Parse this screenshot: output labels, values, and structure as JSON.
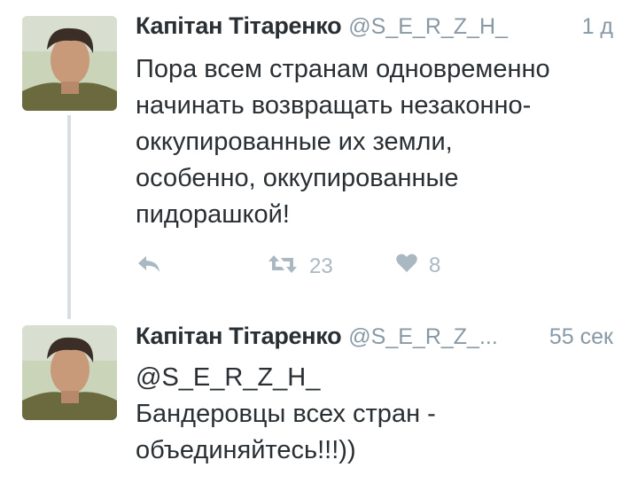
{
  "tweets": [
    {
      "author_name": "Капітан Тітаренко",
      "handle": "@S_E_R_Z_H_",
      "time": "1 д",
      "text": "Пора всем странам одновременно\nначинать возвращать незаконно-\nоккупированные их земли,\nособенно, оккупированные\nпидорашкой!",
      "retweets": "23",
      "likes": "8"
    },
    {
      "author_name": "Капітан Тітаренко",
      "handle": "@S_E_R_Z_...",
      "time": "55 сек",
      "text": "@S_E_R_Z_H_\nБандеровцы всех стран -\nобъединяйтесь!!!))"
    }
  ],
  "icons": {
    "reply": "reply-icon",
    "retweet": "retweet-icon",
    "like": "heart-icon"
  },
  "colors": {
    "text": "#292f33",
    "muted": "#8899a6",
    "icon": "#aab8c2",
    "thread_line": "#d9dee2"
  }
}
